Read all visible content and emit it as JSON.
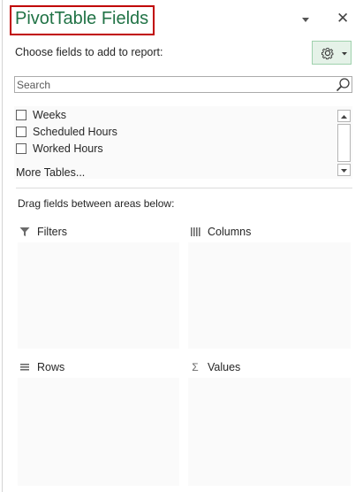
{
  "pane": {
    "title": "PivotTable Fields",
    "dropdown_icon": "triangle-down-icon",
    "close_glyph": "✕"
  },
  "header": {
    "subtitle": "Choose fields to add to report:",
    "settings_icon": "gear-icon"
  },
  "search": {
    "placeholder": "Search",
    "value": ""
  },
  "fields": [
    {
      "label": "Weeks",
      "checked": false
    },
    {
      "label": "Scheduled Hours",
      "checked": false
    },
    {
      "label": "Worked Hours",
      "checked": false
    }
  ],
  "more_tables": "More Tables...",
  "drag_hint": "Drag fields between areas below:",
  "areas": {
    "filters": {
      "label": "Filters",
      "icon": "filter-icon"
    },
    "columns": {
      "label": "Columns",
      "icon": "columns-icon"
    },
    "rows": {
      "label": "Rows",
      "icon": "rows-icon"
    },
    "values": {
      "label": "Values",
      "icon": "sigma-icon",
      "glyph": "Σ"
    }
  },
  "colors": {
    "title_green": "#217346",
    "highlight_red": "#c00000",
    "settings_bg": "#e5f2e8"
  }
}
